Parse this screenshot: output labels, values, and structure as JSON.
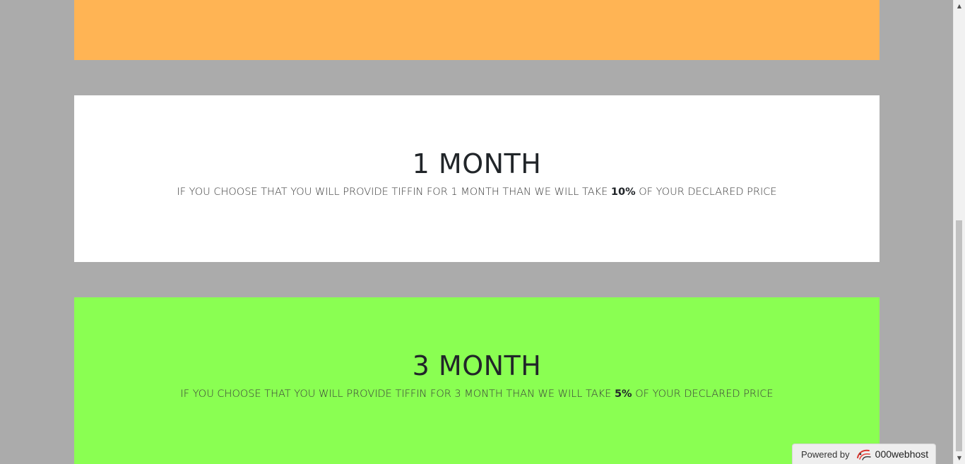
{
  "colors": {
    "page_background": "#ababab",
    "orange_card": "#ffb454",
    "white_card": "#ffffff",
    "green_card": "#8aff52"
  },
  "plans": [
    {
      "title": "1 MONTH",
      "desc_prefix": "IF YOU CHOOSE THAT YOU WILL PROVIDE TIFFIN FOR 1 MONTH THAN WE WILL TAKE ",
      "percent": "10%",
      "desc_suffix": " OF YOUR DECLARED PRICE"
    },
    {
      "title": "3 MONTH",
      "desc_prefix": "IF YOU CHOOSE THAT YOU WILL PROVIDE TIFFIN FOR 3 MONTH THAN WE WILL TAKE ",
      "percent": "5%",
      "desc_suffix": " OF YOUR DECLARED PRICE"
    }
  ],
  "badge": {
    "powered_label": "Powered by",
    "brand": "000webhost",
    "icon": "000webhost-logo-icon"
  },
  "scrollbar": {
    "up_icon": "scroll-up-arrow-icon",
    "down_icon": "scroll-down-arrow-icon"
  }
}
